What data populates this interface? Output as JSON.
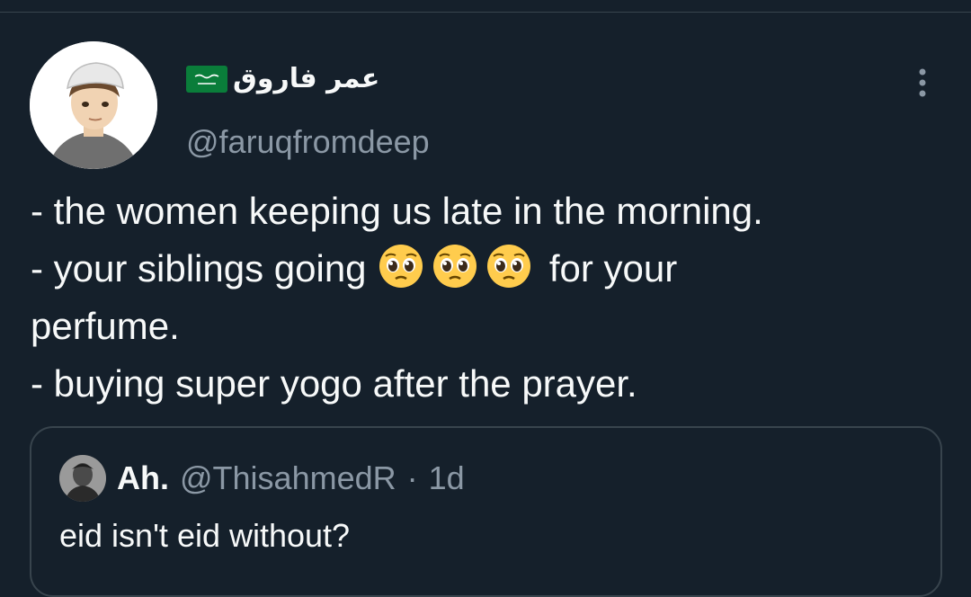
{
  "tweet": {
    "author": {
      "display_name": "عمر فاروق",
      "flag_icon": "saudi-flag-icon",
      "handle": "@faruqfromdeep"
    },
    "more_icon": "more-vertical-icon",
    "lines": [
      {
        "text": "- the women keeping us late in the morning."
      },
      {
        "text_before": "- your siblings going",
        "emoji": "pleading-face-icon",
        "emoji_count": 3,
        "text_after": "for your"
      },
      {
        "text": "perfume."
      },
      {
        "text": "- buying super yogo after the prayer."
      }
    ]
  },
  "quoted_tweet": {
    "display_name": "Ah.",
    "handle": "@ThisahmedR",
    "separator": "·",
    "time": "1d",
    "text": "eid isn't eid without?"
  },
  "colors": {
    "background": "#15202b",
    "text_primary": "#f7f9f9",
    "text_secondary": "#8b98a5",
    "border": "#38444d"
  }
}
